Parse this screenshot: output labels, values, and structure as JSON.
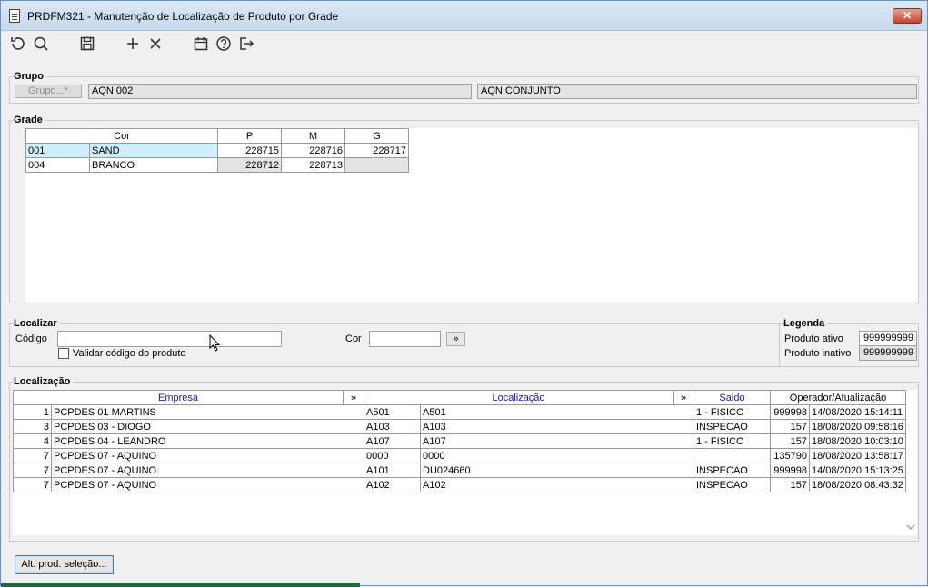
{
  "window": {
    "title": "PRDFM321 - Manutenção de Localização de Produto por Grade",
    "close_label": "✕"
  },
  "toolbar": {
    "icons": [
      "refresh-icon",
      "search-icon",
      "save-icon",
      "add-icon",
      "delete-icon",
      "calendar-icon",
      "help-icon",
      "exit-icon"
    ]
  },
  "grupo": {
    "legend": "Grupo",
    "button_label": "Grupo...*",
    "code": "AQN 002",
    "description": "AQN CONJUNTO"
  },
  "grade": {
    "legend": "Grade",
    "headers": [
      "Cor",
      "P",
      "M",
      "G"
    ],
    "rows": [
      {
        "code": "001",
        "color": "SAND",
        "p": "228715",
        "m": "228716",
        "g": "228717"
      },
      {
        "code": "004",
        "color": "BRANCO",
        "p": "228712",
        "m": "228713",
        "g": ""
      }
    ]
  },
  "localizar": {
    "legend": "Localizar",
    "codigo_label": "Código",
    "codigo_value": "",
    "validar_label": "Validar código do produto",
    "cor_label": "Cor",
    "cor_value": "",
    "go_label": "»"
  },
  "legenda": {
    "legend": "Legenda",
    "ativo_label": "Produto ativo",
    "ativo_value": "999999999",
    "inativo_label": "Produto inativo",
    "inativo_value": "999999999"
  },
  "localizacao": {
    "legend": "Localização",
    "headers": {
      "empresa": "Empresa",
      "empresa_more": "»",
      "localizacao": "Localização",
      "localizacao_more": "»",
      "saldo": "Saldo",
      "operador": "Operador/Atualização"
    },
    "rows": [
      {
        "num": "1",
        "empresa": "PCPDES 01 MARTINS",
        "loc_code": "A501",
        "loc_desc": "A501",
        "saldo": "1 - FISICO",
        "qty": "999998",
        "date": "14/08/2020 15:14:11"
      },
      {
        "num": "3",
        "empresa": "PCPDES 03 - DIOGO",
        "loc_code": "A103",
        "loc_desc": "A103",
        "saldo": "INSPECAO",
        "qty": "157",
        "date": "18/08/2020 09:58:16"
      },
      {
        "num": "4",
        "empresa": "PCPDES 04 - LEANDRO",
        "loc_code": "A107",
        "loc_desc": "A107",
        "saldo": "1 - FISICO",
        "qty": "157",
        "date": "18/08/2020 10:03:10"
      },
      {
        "num": "7",
        "empresa": "PCPDES 07 - AQUINO",
        "loc_code": "0000",
        "loc_desc": "0000",
        "saldo": "",
        "qty": "135790",
        "date": "18/08/2020 13:58:17"
      },
      {
        "num": "7",
        "empresa": "PCPDES 07 - AQUINO",
        "loc_code": "A101",
        "loc_desc": "DU024660",
        "saldo": "INSPECAO",
        "qty": "999998",
        "date": "14/08/2020 15:13:25"
      },
      {
        "num": "7",
        "empresa": "PCPDES 07 - AQUINO",
        "loc_code": "A102",
        "loc_desc": "A102",
        "saldo": "INSPECAO",
        "qty": "157",
        "date": "18/08/2020 08:43:32"
      }
    ]
  },
  "footer": {
    "alt_button_label": "Alt. prod. seleção..."
  }
}
